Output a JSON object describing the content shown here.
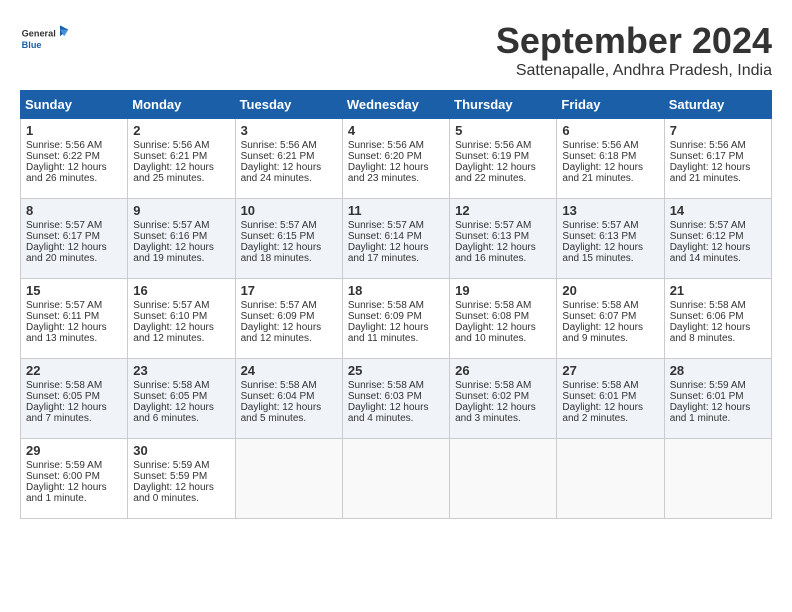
{
  "header": {
    "logo_general": "General",
    "logo_blue": "Blue",
    "month_title": "September 2024",
    "location": "Sattenapalle, Andhra Pradesh, India"
  },
  "days_of_week": [
    "Sunday",
    "Monday",
    "Tuesday",
    "Wednesday",
    "Thursday",
    "Friday",
    "Saturday"
  ],
  "weeks": [
    [
      {
        "day": "1",
        "sunrise": "5:56 AM",
        "sunset": "6:22 PM",
        "daylight": "12 hours and 26 minutes."
      },
      {
        "day": "2",
        "sunrise": "5:56 AM",
        "sunset": "6:21 PM",
        "daylight": "12 hours and 25 minutes."
      },
      {
        "day": "3",
        "sunrise": "5:56 AM",
        "sunset": "6:21 PM",
        "daylight": "12 hours and 24 minutes."
      },
      {
        "day": "4",
        "sunrise": "5:56 AM",
        "sunset": "6:20 PM",
        "daylight": "12 hours and 23 minutes."
      },
      {
        "day": "5",
        "sunrise": "5:56 AM",
        "sunset": "6:19 PM",
        "daylight": "12 hours and 22 minutes."
      },
      {
        "day": "6",
        "sunrise": "5:56 AM",
        "sunset": "6:18 PM",
        "daylight": "12 hours and 21 minutes."
      },
      {
        "day": "7",
        "sunrise": "5:56 AM",
        "sunset": "6:17 PM",
        "daylight": "12 hours and 21 minutes."
      }
    ],
    [
      {
        "day": "8",
        "sunrise": "5:57 AM",
        "sunset": "6:17 PM",
        "daylight": "12 hours and 20 minutes."
      },
      {
        "day": "9",
        "sunrise": "5:57 AM",
        "sunset": "6:16 PM",
        "daylight": "12 hours and 19 minutes."
      },
      {
        "day": "10",
        "sunrise": "5:57 AM",
        "sunset": "6:15 PM",
        "daylight": "12 hours and 18 minutes."
      },
      {
        "day": "11",
        "sunrise": "5:57 AM",
        "sunset": "6:14 PM",
        "daylight": "12 hours and 17 minutes."
      },
      {
        "day": "12",
        "sunrise": "5:57 AM",
        "sunset": "6:13 PM",
        "daylight": "12 hours and 16 minutes."
      },
      {
        "day": "13",
        "sunrise": "5:57 AM",
        "sunset": "6:13 PM",
        "daylight": "12 hours and 15 minutes."
      },
      {
        "day": "14",
        "sunrise": "5:57 AM",
        "sunset": "6:12 PM",
        "daylight": "12 hours and 14 minutes."
      }
    ],
    [
      {
        "day": "15",
        "sunrise": "5:57 AM",
        "sunset": "6:11 PM",
        "daylight": "12 hours and 13 minutes."
      },
      {
        "day": "16",
        "sunrise": "5:57 AM",
        "sunset": "6:10 PM",
        "daylight": "12 hours and 12 minutes."
      },
      {
        "day": "17",
        "sunrise": "5:57 AM",
        "sunset": "6:09 PM",
        "daylight": "12 hours and 12 minutes."
      },
      {
        "day": "18",
        "sunrise": "5:58 AM",
        "sunset": "6:09 PM",
        "daylight": "12 hours and 11 minutes."
      },
      {
        "day": "19",
        "sunrise": "5:58 AM",
        "sunset": "6:08 PM",
        "daylight": "12 hours and 10 minutes."
      },
      {
        "day": "20",
        "sunrise": "5:58 AM",
        "sunset": "6:07 PM",
        "daylight": "12 hours and 9 minutes."
      },
      {
        "day": "21",
        "sunrise": "5:58 AM",
        "sunset": "6:06 PM",
        "daylight": "12 hours and 8 minutes."
      }
    ],
    [
      {
        "day": "22",
        "sunrise": "5:58 AM",
        "sunset": "6:05 PM",
        "daylight": "12 hours and 7 minutes."
      },
      {
        "day": "23",
        "sunrise": "5:58 AM",
        "sunset": "6:05 PM",
        "daylight": "12 hours and 6 minutes."
      },
      {
        "day": "24",
        "sunrise": "5:58 AM",
        "sunset": "6:04 PM",
        "daylight": "12 hours and 5 minutes."
      },
      {
        "day": "25",
        "sunrise": "5:58 AM",
        "sunset": "6:03 PM",
        "daylight": "12 hours and 4 minutes."
      },
      {
        "day": "26",
        "sunrise": "5:58 AM",
        "sunset": "6:02 PM",
        "daylight": "12 hours and 3 minutes."
      },
      {
        "day": "27",
        "sunrise": "5:58 AM",
        "sunset": "6:01 PM",
        "daylight": "12 hours and 2 minutes."
      },
      {
        "day": "28",
        "sunrise": "5:59 AM",
        "sunset": "6:01 PM",
        "daylight": "12 hours and 1 minute."
      }
    ],
    [
      {
        "day": "29",
        "sunrise": "5:59 AM",
        "sunset": "6:00 PM",
        "daylight": "12 hours and 1 minute."
      },
      {
        "day": "30",
        "sunrise": "5:59 AM",
        "sunset": "5:59 PM",
        "daylight": "12 hours and 0 minutes."
      },
      null,
      null,
      null,
      null,
      null
    ]
  ]
}
